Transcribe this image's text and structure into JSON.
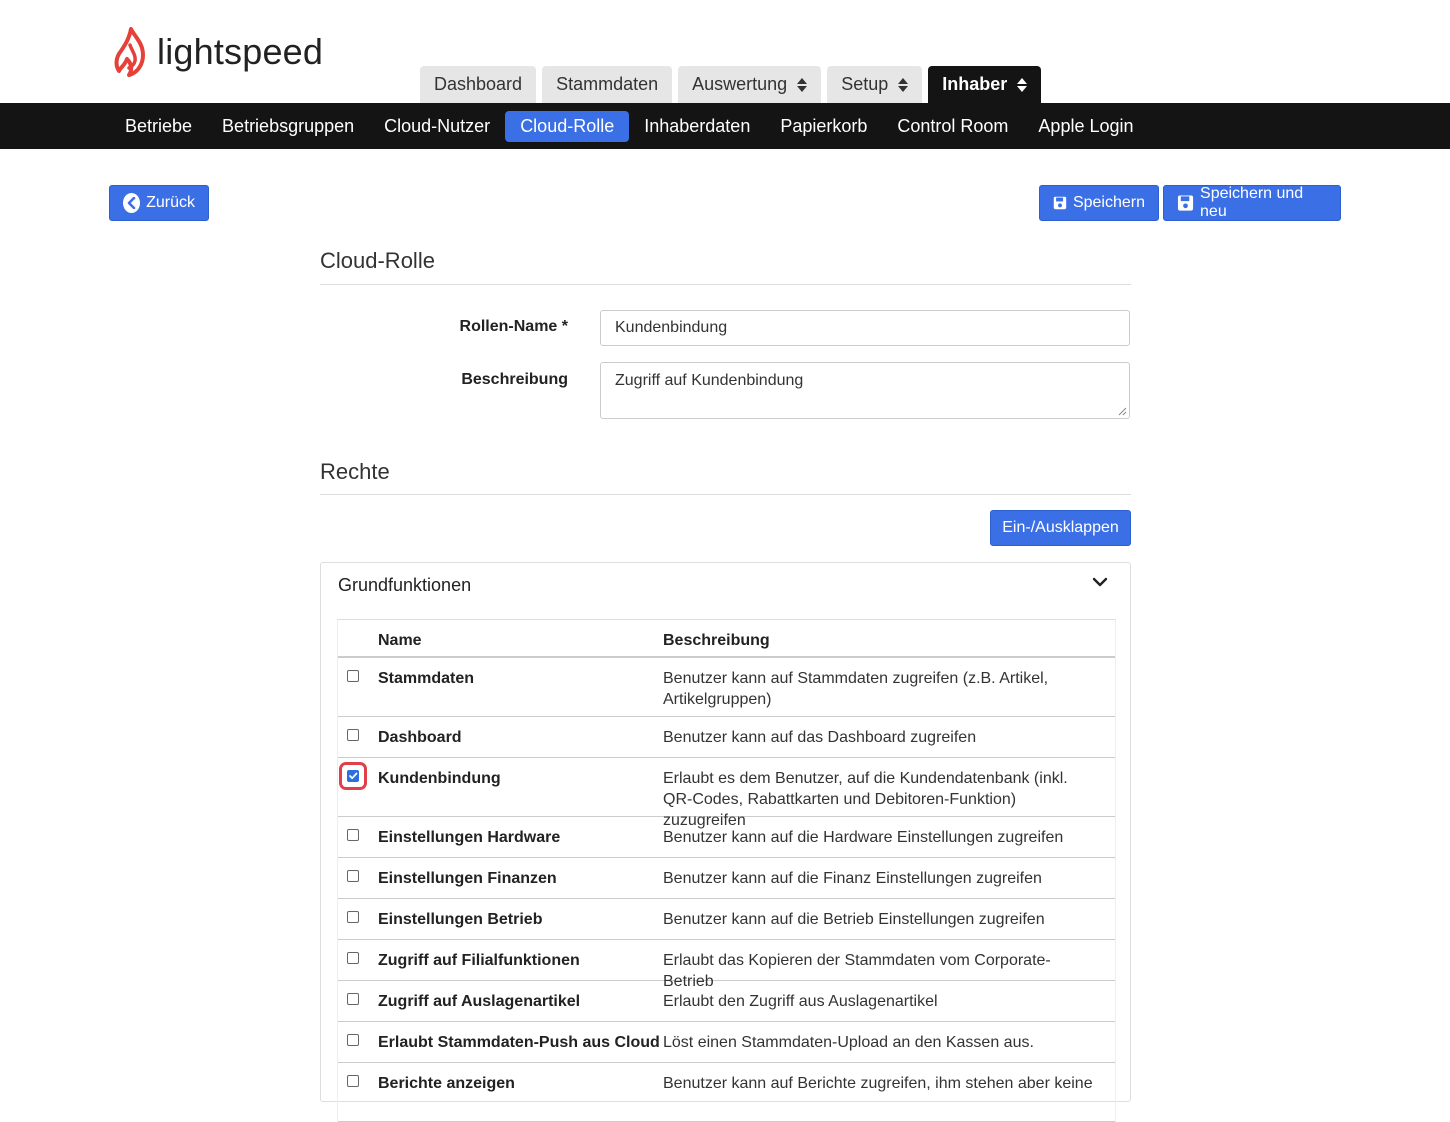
{
  "header": {
    "logo_text": "lightspeed",
    "top_tabs": [
      {
        "label": "Dashboard",
        "has_dropdown": false,
        "active": false
      },
      {
        "label": "Stammdaten",
        "has_dropdown": false,
        "active": false
      },
      {
        "label": "Auswertung",
        "has_dropdown": true,
        "active": false
      },
      {
        "label": "Setup",
        "has_dropdown": true,
        "active": false
      },
      {
        "label": "Inhaber",
        "has_dropdown": true,
        "active": true
      }
    ],
    "nav_items": [
      {
        "label": "Betriebe",
        "active": false
      },
      {
        "label": "Betriebsgruppen",
        "active": false
      },
      {
        "label": "Cloud-Nutzer",
        "active": false
      },
      {
        "label": "Cloud-Rolle",
        "active": true
      },
      {
        "label": "Inhaberdaten",
        "active": false
      },
      {
        "label": "Papierkorb",
        "active": false
      },
      {
        "label": "Control Room",
        "active": false
      },
      {
        "label": "Apple Login",
        "active": false
      }
    ]
  },
  "actions": {
    "back_label": "Zurück",
    "save_label": "Speichern",
    "save_new_label": "Speichern und neu"
  },
  "form": {
    "section_title": "Cloud-Rolle",
    "role_name_label": "Rollen-Name *",
    "role_name_value": "Kundenbindung",
    "description_label": "Beschreibung",
    "description_value": "Zugriff auf Kundenbindung"
  },
  "rights": {
    "section_title": "Rechte",
    "toggle_label": "Ein-/Ausklappen",
    "panel_title": "Grundfunktionen",
    "columns": {
      "name": "Name",
      "description": "Beschreibung"
    },
    "rows": [
      {
        "name": "Stammdaten",
        "description": "Benutzer kann auf Stammdaten zugreifen (z.B. Artikel, Artikelgruppen)",
        "checked": false
      },
      {
        "name": "Dashboard",
        "description": "Benutzer kann auf das Dashboard zugreifen",
        "checked": false
      },
      {
        "name": "Kundenbindung",
        "description": "Erlaubt es dem Benutzer, auf die Kundendatenbank (inkl. QR-Codes, Rabattkarten und Debitoren-Funktion) zuzugreifen",
        "checked": true,
        "highlighted": true
      },
      {
        "name": "Einstellungen Hardware",
        "description": "Benutzer kann auf die Hardware Einstellungen zugreifen",
        "checked": false
      },
      {
        "name": "Einstellungen Finanzen",
        "description": "Benutzer kann auf die Finanz Einstellungen zugreifen",
        "checked": false
      },
      {
        "name": "Einstellungen Betrieb",
        "description": "Benutzer kann auf die Betrieb Einstellungen zugreifen",
        "checked": false
      },
      {
        "name": "Zugriff auf Filialfunktionen",
        "description": "Erlaubt das Kopieren der Stammdaten vom Corporate-Betrieb",
        "checked": false
      },
      {
        "name": "Zugriff auf Auslagenartikel",
        "description": "Erlaubt den Zugriff aus Auslagenartikel",
        "checked": false
      },
      {
        "name": "Erlaubt Stammdaten-Push aus Cloud",
        "description": "Löst einen Stammdaten-Upload an den Kassen aus.",
        "checked": false
      },
      {
        "name": "Berichte anzeigen",
        "description": "Benutzer kann auf Berichte zugreifen, ihm stehen aber keine",
        "checked": false
      }
    ]
  },
  "colors": {
    "primary": "#3b6fe5",
    "nav_bg": "#141414",
    "logo_red": "#e5413a",
    "highlight": "#e0404a"
  }
}
